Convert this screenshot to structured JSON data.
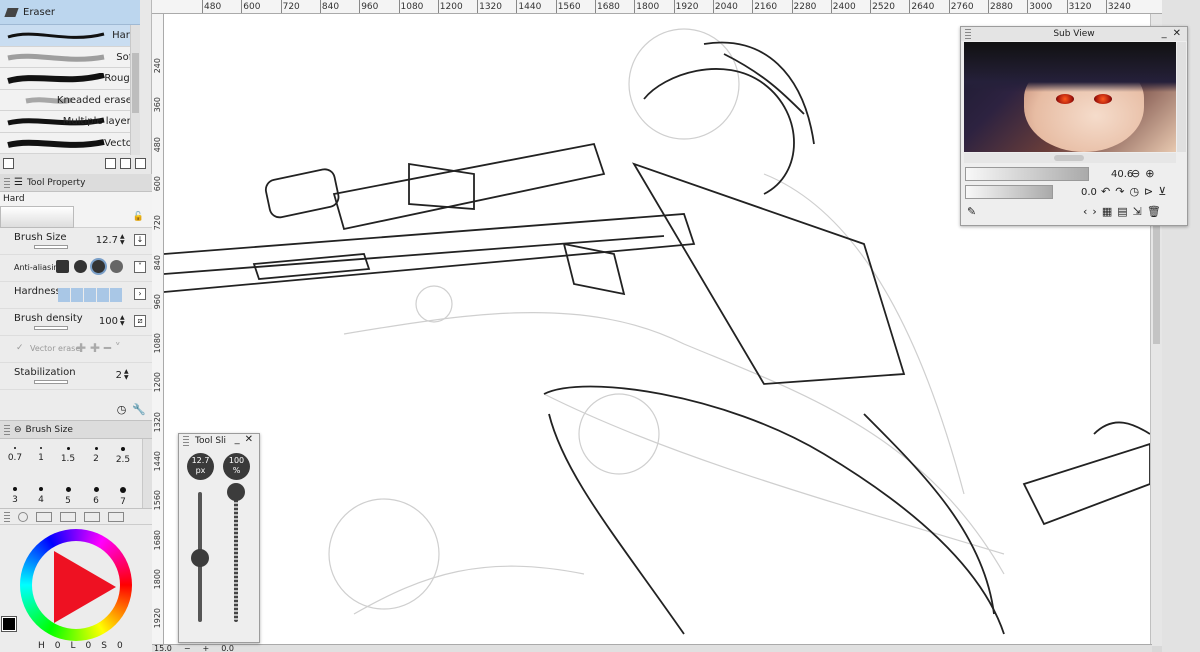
{
  "subtool": {
    "title": "Eraser",
    "brushes": [
      {
        "label": "Hard",
        "selected": true
      },
      {
        "label": "Soft",
        "selected": false
      },
      {
        "label": "Rough",
        "selected": false
      },
      {
        "label": "Kneaded eraser",
        "selected": false
      },
      {
        "label": "Multiple layers",
        "selected": false
      },
      {
        "label": "Vector",
        "selected": false
      }
    ]
  },
  "tool_property": {
    "title": "Tool Property",
    "preview_name": "Hard",
    "brush_size_label": "Brush Size",
    "brush_size_value": "12.7",
    "anti_alias_label": "Anti-aliasin",
    "hardness_label": "Hardness",
    "brush_density_label": "Brush density",
    "brush_density_value": "100",
    "vector_erase_label": "Vector erase",
    "stabilization_label": "Stabilization",
    "stabilization_value": "2"
  },
  "brush_size_palette": {
    "title": "Brush Size",
    "sizes": [
      "0.7",
      "1",
      "1.5",
      "2",
      "2.5",
      "3",
      "4",
      "5",
      "6",
      "7"
    ]
  },
  "color": {
    "main": "#000000",
    "readout": [
      "H",
      "0",
      "L",
      "0",
      "S",
      "0"
    ]
  },
  "h_ruler": [
    "480",
    "600",
    "720",
    "840",
    "960",
    "1080",
    "1200",
    "1320",
    "1440",
    "1560",
    "1680",
    "1800",
    "1920",
    "2040",
    "2160",
    "2280",
    "2400",
    "2520",
    "2640",
    "2760",
    "2880",
    "3000",
    "3120",
    "3240"
  ],
  "v_ruler": [
    "240",
    "360",
    "480",
    "600",
    "720",
    "840",
    "960",
    "1080",
    "1200",
    "1320",
    "1440",
    "1560",
    "1680",
    "1800",
    "1920"
  ],
  "sub_view": {
    "title": "Sub View",
    "zoom_value": "40.6",
    "rotation_value": "0.0"
  },
  "tool_slider": {
    "title": "Tool Sli",
    "size_value": "12.7",
    "size_unit": "px",
    "opacity_value": "100",
    "opacity_unit": "%"
  },
  "status": {
    "zoom": "15.0",
    "angle": "0.0"
  }
}
